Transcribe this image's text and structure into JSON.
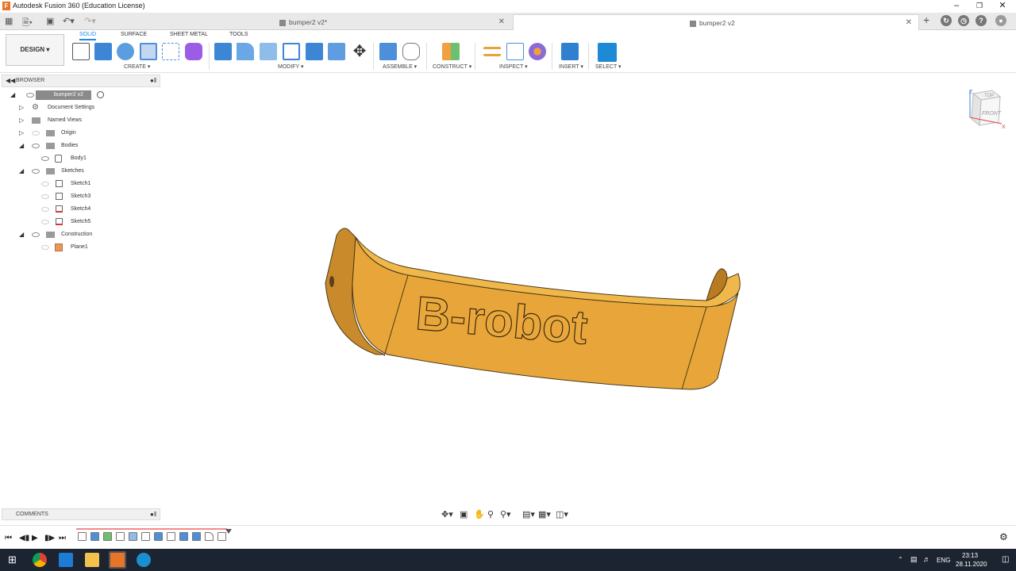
{
  "window": {
    "title": "Autodesk Fusion 360 (Education License)",
    "app_icon_letter": "F"
  },
  "tabs": [
    {
      "label": "bumper2 v2*",
      "active": false
    },
    {
      "label": "bumper2 v2",
      "active": true
    }
  ],
  "workspace": {
    "label": "DESIGN ▾"
  },
  "toolbar_tabs": [
    {
      "label": "SOLID",
      "active": true
    },
    {
      "label": "SURFACE",
      "active": false
    },
    {
      "label": "SHEET METAL",
      "active": false
    },
    {
      "label": "TOOLS",
      "active": false
    }
  ],
  "tool_groups": [
    {
      "label": "CREATE ▾"
    },
    {
      "label": "MODIFY ▾"
    },
    {
      "label": "ASSEMBLE ▾"
    },
    {
      "label": "CONSTRUCT ▾"
    },
    {
      "label": "INSPECT ▾"
    },
    {
      "label": "INSERT ▾"
    },
    {
      "label": "SELECT ▾"
    }
  ],
  "browser": {
    "title": "BROWSER",
    "root": "bumper2 v2",
    "items": [
      {
        "label": "Document Settings"
      },
      {
        "label": "Named Views"
      },
      {
        "label": "Origin"
      },
      {
        "label": "Bodies"
      },
      {
        "label": "Body1"
      },
      {
        "label": "Sketches"
      },
      {
        "label": "Sketch1"
      },
      {
        "label": "Sketch3"
      },
      {
        "label": "Sketch4"
      },
      {
        "label": "Sketch5"
      },
      {
        "label": "Construction"
      },
      {
        "label": "Plane1"
      }
    ]
  },
  "viewcube": {
    "top": "TOP",
    "front": "FRONT",
    "axis_z": "Z",
    "axis_x": "X"
  },
  "model": {
    "emboss_text": "B-robot",
    "color": "#e0a338"
  },
  "comments": {
    "title": "COMMENTS"
  },
  "taskbar": {
    "language": "ENG",
    "time": "23:13",
    "date": "28.11.2020"
  },
  "colors": {
    "accent": "#1e88e5",
    "body": "#e0a338",
    "taskbar": "#1b2430"
  }
}
